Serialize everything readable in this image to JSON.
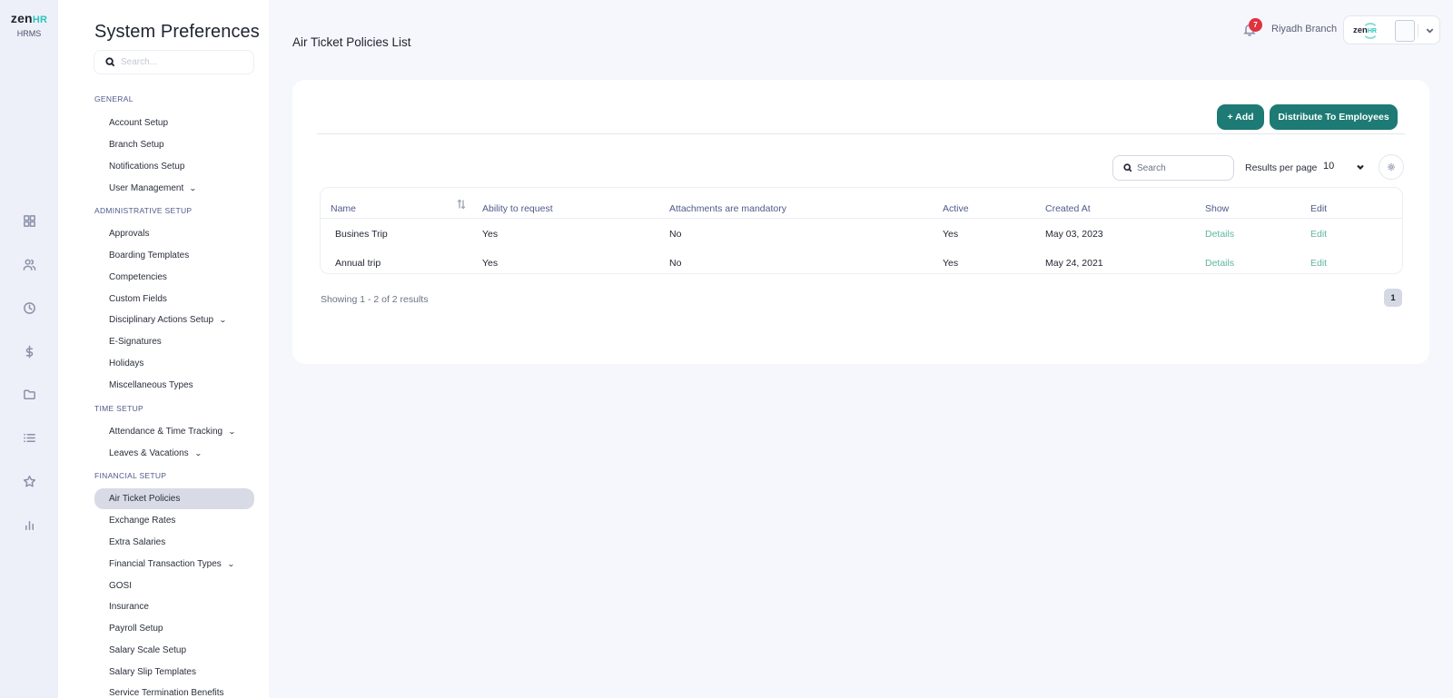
{
  "brand": {
    "logo_text": "zen",
    "logo_accent": "HR",
    "product": "HRMS",
    "accent_color": "#2cc4be"
  },
  "rail": {
    "icons": [
      "grid-icon",
      "people-icon",
      "clock-icon",
      "dollar-icon",
      "folder-icon",
      "list-icon",
      "star-icon",
      "bar-chart-icon"
    ]
  },
  "sidebar": {
    "title": "System Preferences",
    "search_placeholder": "Search...",
    "sections": {
      "general": "GENERAL",
      "administrative": "ADMINISTRATIVE SETUP",
      "time": "TIME SETUP",
      "financial": "FINANCIAL SETUP"
    },
    "items": {
      "account_setup": "Account Setup",
      "branch_setup": "Branch Setup",
      "notifications_setup": "Notifications Setup",
      "user_management": "User Management",
      "approvals": "Approvals",
      "boarding_templates": "Boarding Templates",
      "competencies": "Competencies",
      "custom_fields": "Custom Fields",
      "disciplinary": "Disciplinary Actions Setup",
      "e_signatures": "E-Signatures",
      "holidays": "Holidays",
      "misc_types": "Miscellaneous Types",
      "attendance": "Attendance & Time Tracking",
      "leaves": "Leaves & Vacations",
      "air_ticket": "Air Ticket Policies",
      "exchange_rates": "Exchange Rates",
      "extra_salaries": "Extra Salaries",
      "financial_transaction": "Financial Transaction Types",
      "gosi": "GOSI",
      "insurance": "Insurance",
      "payroll_setup": "Payroll Setup",
      "salary_scale": "Salary Scale Setup",
      "salary_slip": "Salary Slip Templates",
      "service_termination": "Service Termination Benefits"
    },
    "active_item": "Air Ticket Policies"
  },
  "header": {
    "title": "Air Ticket Policies List",
    "notifications_count": "7",
    "branch": "Riyadh Branch",
    "account_logo": "zen",
    "account_logo_accent": "HR"
  },
  "toolbar": {
    "add_label": "+ Add",
    "distribute_label": "Distribute To Employees",
    "button_color": "#1d7a74",
    "search_placeholder": "Search",
    "results_per_page_label": "Results per page",
    "results_per_page_value": "10"
  },
  "table": {
    "headers": {
      "name": "Name",
      "ability": "Ability to request",
      "attachments": "Attachments are mandatory",
      "active": "Active",
      "created": "Created At",
      "show": "Show",
      "edit": "Edit"
    },
    "rows": [
      {
        "name": "Busines Trip",
        "ability": "Yes",
        "attachments": "No",
        "active": "Yes",
        "created": "May 03, 2023",
        "show": "Details",
        "edit": "Edit"
      },
      {
        "name": "Annual trip",
        "ability": "Yes",
        "attachments": "No",
        "active": "Yes",
        "created": "May 24, 2021",
        "show": "Details",
        "edit": "Edit"
      }
    ]
  },
  "pagination": {
    "summary": "Showing 1 - 2 of 2 results",
    "current_page": "1"
  }
}
